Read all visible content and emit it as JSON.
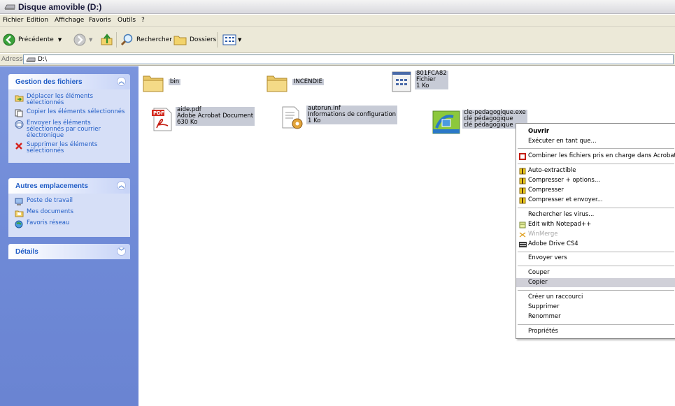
{
  "window": {
    "title": "Disque amovible (D:)"
  },
  "menu": [
    "Fichier",
    "Edition",
    "Affichage",
    "Favoris",
    "Outils",
    "?"
  ],
  "toolbar": {
    "back": "Précédente",
    "search": "Rechercher",
    "folders": "Dossiers"
  },
  "address": {
    "label": "Adresse",
    "value": "D:\\"
  },
  "taskpane": {
    "file_tasks": {
      "title": "Gestion des fichiers",
      "items": [
        "Déplacer les éléments sélectionnés",
        "Copier les éléments sélectionnés",
        "Envoyer les éléments sélectionnés par courrier électronique",
        "Supprimer les éléments sélectionnés"
      ]
    },
    "other_places": {
      "title": "Autres emplacements",
      "items": [
        "Poste de travail",
        "Mes documents",
        "Favoris réseau"
      ]
    },
    "details": {
      "title": "Détails"
    }
  },
  "files": {
    "bin": {
      "name": "bin"
    },
    "incendie": {
      "name": "INCENDIE"
    },
    "f801": {
      "name": "801FCA82",
      "type": "Fichier",
      "size": "1 Ko"
    },
    "aide": {
      "name": "aide.pdf",
      "type": "Adobe Acrobat Document",
      "size": "630 Ko"
    },
    "autorun": {
      "name": "autorun.inf",
      "type": "Informations de configuration",
      "size": "1 Ko"
    },
    "cle": {
      "name": "cle-pedagogique.exe",
      "line2": "clé pédagogique",
      "line3": "clé pédagogique"
    }
  },
  "context_menu": {
    "open": "Ouvrir",
    "run_as": "Exécuter en tant que...",
    "acrobat": "Combiner les fichiers pris en charge dans Acrobat...",
    "auto_extract": "Auto-extractible",
    "compress_options": "Compresser + options...",
    "compress": "Compresser",
    "compress_send": "Compresser et envoyer...",
    "scan": "Rechercher les virus...",
    "notepad": "Edit with Notepad++",
    "winmerge": "WinMerge",
    "adobe_drive": "Adobe Drive CS4",
    "send_to": "Envoyer vers",
    "cut": "Couper",
    "copy": "Copier",
    "shortcut": "Créer un raccourci",
    "delete": "Supprimer",
    "rename": "Renommer",
    "properties": "Propriétés"
  },
  "icons": {
    "back": "back-arrow-icon",
    "forward": "forward-arrow-icon",
    "up": "up-folder-icon",
    "search": "search-icon",
    "folders": "folders-icon",
    "views": "views-icon",
    "drive": "removable-drive-icon",
    "folder": "folder-icon",
    "pdf": "pdf-icon"
  },
  "colors": {
    "taskpane": "#6f8ad7",
    "link": "#215dc6",
    "selection": "#c7cbd6",
    "chrome": "#ece9d8"
  }
}
